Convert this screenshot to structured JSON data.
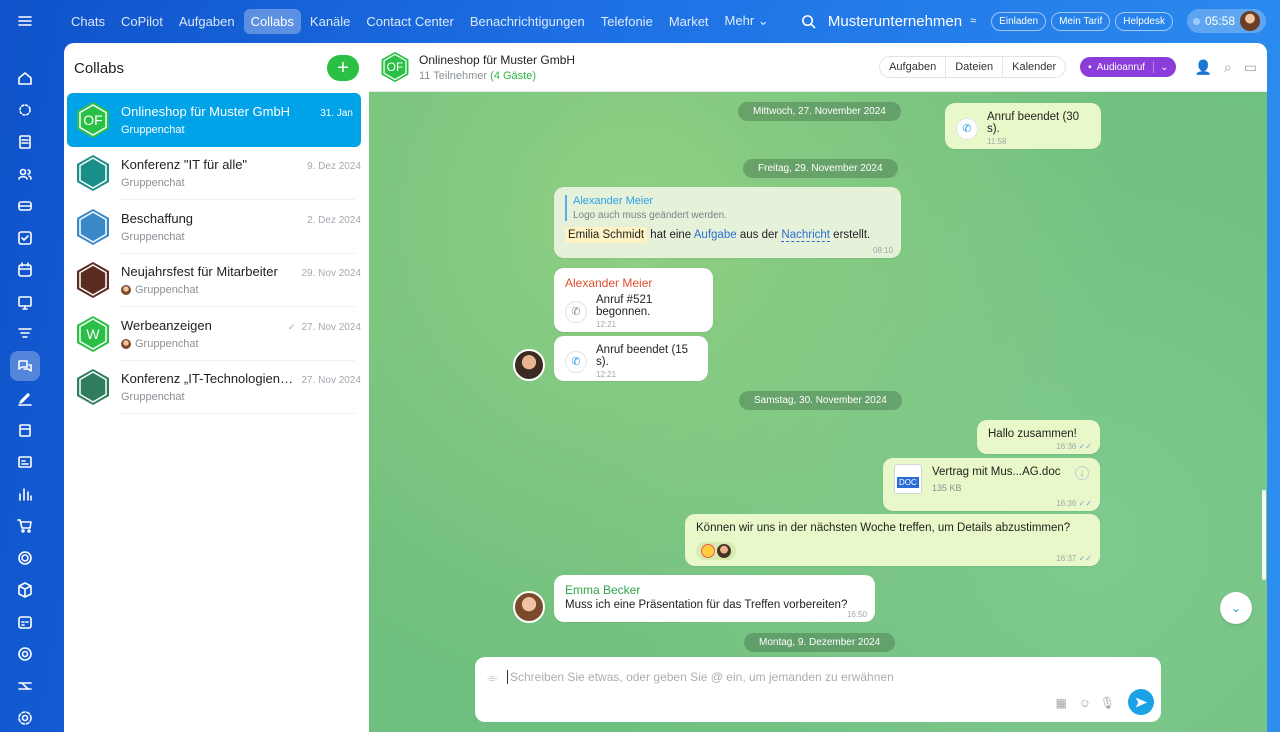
{
  "topnav": [
    "Chats",
    "CoPilot",
    "Aufgaben",
    "Collabs",
    "Kanäle",
    "Contact Center",
    "Benachrichtigungen",
    "Telefonie",
    "Market",
    "Mehr ⌄"
  ],
  "topright": {
    "org": "Musterunternehmen",
    "invite": "Einladen",
    "tariff": "Mein Tarif",
    "helpdesk": "Helpdesk",
    "time": "05:58"
  },
  "sidebar": {
    "title": "Collabs",
    "chats": [
      {
        "name": "Onlineshop für Muster GmbH",
        "date": "31. Jan",
        "sub": "Gruppenchat",
        "initials": "OF",
        "color": "#29c045"
      },
      {
        "name": "Konferenz \"IT für alle\"",
        "date": "9. Dez 2024",
        "sub": "Gruppenchat",
        "initials": "",
        "color": "#1a8f8a"
      },
      {
        "name": "Beschaffung",
        "date": "2. Dez 2024",
        "sub": "Gruppenchat",
        "initials": "",
        "color": "#3b88c9"
      },
      {
        "name": "Neujahrsfest für Mitarbeiter",
        "date": "29. Nov 2024",
        "sub": "Gruppenchat",
        "initials": "",
        "color": "#5a2c1f"
      },
      {
        "name": "Werbeanzeigen",
        "date": "27. Nov 2024",
        "sub": "Gruppenchat",
        "initials": "W",
        "color": "#29c045"
      },
      {
        "name": "Konferenz „IT-Technologien“ ...",
        "date": "27. Nov 2024",
        "sub": "Gruppenchat",
        "initials": "",
        "color": "#2f7d5e"
      }
    ]
  },
  "chat": {
    "title": "Onlineshop für Muster GmbH",
    "members": "11 Teilnehmer",
    "guests": "(4 Gäste)",
    "avatar_initials": "OF",
    "tabs": [
      "Aufgaben",
      "Dateien",
      "Kalender"
    ],
    "audio": "Audioanruf",
    "dates": [
      "Mittwoch, 27. November 2024",
      "Freitag, 29. November 2024",
      "Samstag, 30. November 2024",
      "Montag, 9. Dezember 2024"
    ],
    "msg_call_end_30": {
      "text": "Anruf beendet (30 s).",
      "time": "11:58"
    },
    "msg_quote": {
      "quote_name": "Alexander Meier",
      "quote_text": "Logo auch muss geändert werden.",
      "mention": "Emilia Schmidt",
      "t1": "hat eine",
      "link1": "Aufgabe",
      "t2": "aus der",
      "link2": "Nachricht",
      "t3": "erstellt.",
      "time": "08:10"
    },
    "msg_call_start": {
      "sender": "Alexander Meier",
      "text": "Anruf #521 begonnen.",
      "time": "12:21"
    },
    "msg_call_end_15": {
      "text": "Anruf beendet (15 s).",
      "time": "12:21"
    },
    "msg_hallo": {
      "text": "Hallo zusammen!",
      "time": "16:36"
    },
    "msg_file": {
      "name": "Vertrag mit Mus...AG.doc",
      "size": "135 KB",
      "badge": "DOC",
      "time": "16:36"
    },
    "msg_meet": {
      "text": "Können wir uns in der nächsten Woche treffen, um Details abzustimmen?",
      "time": "16:37"
    },
    "msg_emma": {
      "sender": "Emma Becker",
      "text": "Muss ich eine Präsentation für das Treffen vorbereiten?",
      "time": "16:50"
    },
    "composer_placeholder": "Schreiben Sie etwas, oder geben Sie @ ein, um jemanden zu erwähnen"
  },
  "colors": {
    "accent": "#00a2e8",
    "brand_green": "#29c045",
    "audio": "#8b3ddb",
    "outgoing": "#e9f8c8"
  }
}
